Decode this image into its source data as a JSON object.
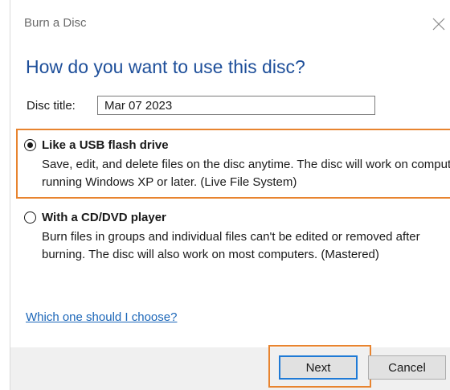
{
  "window": {
    "title": "Burn a Disc"
  },
  "icons": {
    "close": "close-icon"
  },
  "heading": "How do you want to use this disc?",
  "disc_title": {
    "label": "Disc title:",
    "value": "Mar 07 2023"
  },
  "options": [
    {
      "label": "Like a USB flash drive",
      "description": "Save, edit, and delete files on the disc anytime. The disc will work on computers running Windows XP or later. (Live File System)",
      "selected": true
    },
    {
      "label": "With a CD/DVD player",
      "description": "Burn files in groups and individual files can't be edited or removed after burning. The disc will also work on most computers. (Mastered)",
      "selected": false
    }
  ],
  "help_link": "Which one should I choose?",
  "buttons": {
    "next": "Next",
    "cancel": "Cancel"
  },
  "colors": {
    "heading": "#1e4f9a",
    "link": "#1b66b8",
    "highlight": "#e8842f",
    "default_button_border": "#1f7ad6"
  }
}
